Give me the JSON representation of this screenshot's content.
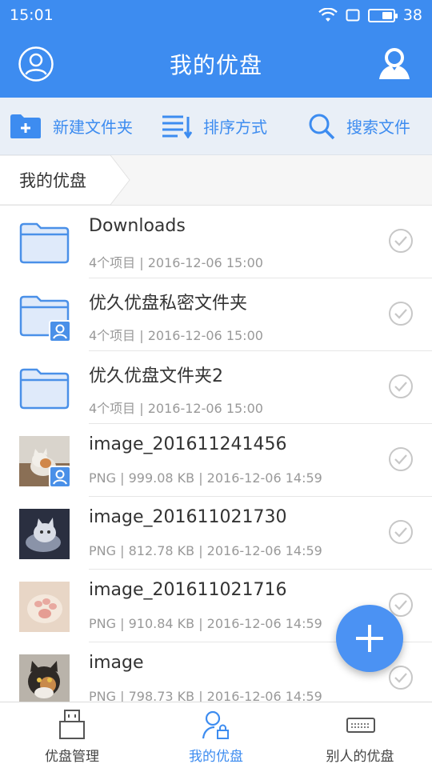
{
  "status_bar": {
    "time": "15:01",
    "battery": "38"
  },
  "app_bar": {
    "title": "我的优盘"
  },
  "toolbar": {
    "new_folder": "新建文件夹",
    "sort": "排序方式",
    "search": "搜索文件"
  },
  "breadcrumb": {
    "current": "我的优盘"
  },
  "files": [
    {
      "name": "Downloads",
      "meta": "4个项目 | 2016-12-06 15:00",
      "kind": "folder",
      "icon": "folder-icon"
    },
    {
      "name": "优久优盘私密文件夹",
      "meta": "4个项目 | 2016-12-06 15:00",
      "kind": "private-folder",
      "icon": "private-folder-icon"
    },
    {
      "name": "优久优盘文件夹2",
      "meta": "4个项目 | 2016-12-06 15:00",
      "kind": "folder",
      "icon": "folder-icon"
    },
    {
      "name": "image_201611241456",
      "meta": "PNG | 999.08 KB | 2016-12-06 14:59",
      "kind": "image",
      "icon": "image-thumbnail"
    },
    {
      "name": "image_201611021730",
      "meta": "PNG | 812.78 KB | 2016-12-06 14:59",
      "kind": "image",
      "icon": "image-thumbnail"
    },
    {
      "name": "image_201611021716",
      "meta": "PNG | 910.84 KB | 2016-12-06 14:59",
      "kind": "image",
      "icon": "image-thumbnail"
    },
    {
      "name": "image",
      "meta": "PNG | 798.73 KB | 2016-12-06 14:59",
      "kind": "image",
      "icon": "image-thumbnail"
    }
  ],
  "bottom_nav": {
    "items": [
      {
        "label": "优盘管理",
        "icon": "usb-drive-icon",
        "active": false
      },
      {
        "label": "我的优盘",
        "icon": "user-lock-icon",
        "active": true
      },
      {
        "label": "别人的优盘",
        "icon": "keyboard-drive-icon",
        "active": false
      }
    ]
  },
  "colors": {
    "primary": "#3d8cf0",
    "toolbar_bg": "#e9eff7",
    "text": "#333333",
    "meta": "#999999"
  }
}
